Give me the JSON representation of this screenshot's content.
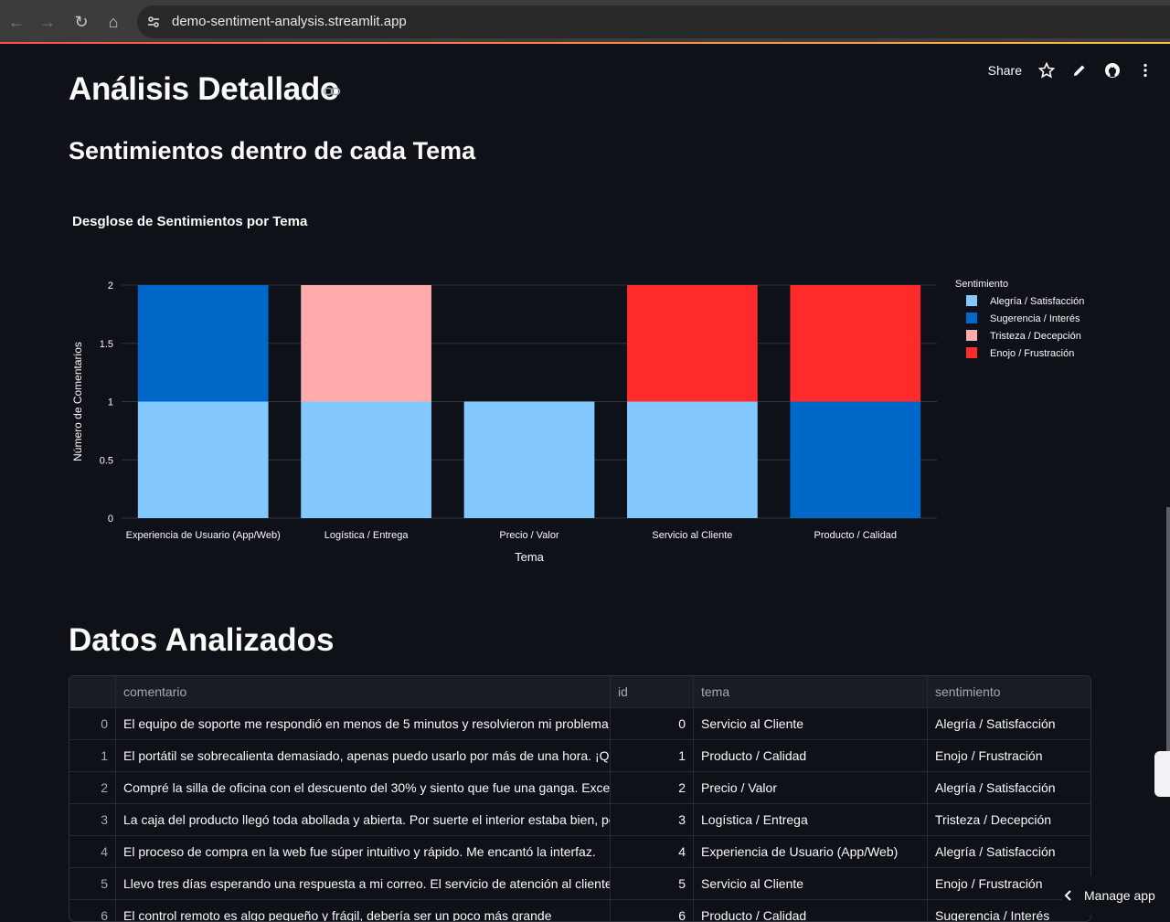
{
  "browser": {
    "url": "demo-sentiment-analysis.streamlit.app",
    "back_icon": "arrow-left-icon",
    "forward_icon": "arrow-right-icon",
    "reload_icon": "reload-icon",
    "home_icon": "home-icon"
  },
  "header": {
    "share_label": "Share"
  },
  "page": {
    "title": "Análisis Detallado",
    "section_title": "Sentimientos dentro de cada Tema",
    "data_title": "Datos Analizados"
  },
  "chart_data": {
    "type": "bar",
    "stacked": true,
    "title": "Desglose de Sentimientos por Tema",
    "xlabel": "Tema",
    "ylabel": "Número de Comentarios",
    "ylim": [
      0,
      2
    ],
    "yticks": [
      "0",
      "0.5",
      "1",
      "1.5",
      "2"
    ],
    "grid": true,
    "legend_title": "Sentimiento",
    "legend_position": "right",
    "categories": [
      "Experiencia de Usuario (App/Web)",
      "Logística / Entrega",
      "Precio / Valor",
      "Servicio al Cliente",
      "Producto / Calidad"
    ],
    "series": [
      {
        "name": "Alegría / Satisfacción",
        "color": "#83c9ff",
        "values": [
          1,
          1,
          1,
          1,
          0
        ]
      },
      {
        "name": "Sugerencia / Interés",
        "color": "#0068c9",
        "values": [
          1,
          0,
          0,
          0,
          1
        ]
      },
      {
        "name": "Tristeza / Decepción",
        "color": "#ffabab",
        "values": [
          0,
          1,
          0,
          0,
          0
        ]
      },
      {
        "name": "Enojo / Frustración",
        "color": "#ff2b2b",
        "values": [
          0,
          0,
          0,
          1,
          1
        ]
      }
    ]
  },
  "table": {
    "columns": [
      "",
      "comentario",
      "id",
      "tema",
      "sentimiento"
    ],
    "rows": [
      {
        "idx": "0",
        "comentario": "El equipo de soporte me respondió en menos de 5 minutos y resolvieron mi problema. ¡Un s",
        "id": "0",
        "tema": "Servicio al Cliente",
        "sentimiento": "Alegría / Satisfacción"
      },
      {
        "idx": "1",
        "comentario": "El portátil se sobrecalienta demasiado, apenas puedo usarlo por más de una hora. ¡Qué frus",
        "id": "1",
        "tema": "Producto / Calidad",
        "sentimiento": "Enojo / Frustración"
      },
      {
        "idx": "2",
        "comentario": "Compré la silla de oficina con el descuento del 30% y siento que fue una ganga. Excelente re",
        "id": "2",
        "tema": "Precio / Valor",
        "sentimiento": "Alegría / Satisfacción"
      },
      {
        "idx": "3",
        "comentario": "La caja del producto llegó toda abollada y abierta. Por suerte el interior estaba bien, pero la",
        "id": "3",
        "tema": "Logística / Entrega",
        "sentimiento": "Tristeza / Decepción"
      },
      {
        "idx": "4",
        "comentario": "El proceso de compra en la web fue súper intuitivo y rápido. Me encantó la interfaz.",
        "id": "4",
        "tema": "Experiencia de Usuario (App/Web)",
        "sentimiento": "Alegría / Satisfacción"
      },
      {
        "idx": "5",
        "comentario": "Llevo tres días esperando una respuesta a mi correo. El servicio de atención al cliente es inex",
        "id": "5",
        "tema": "Servicio al Cliente",
        "sentimiento": "Enojo / Frustración"
      },
      {
        "idx": "6",
        "comentario": "El control remoto es algo pequeño y frágil, debería ser un poco más grande",
        "id": "6",
        "tema": "Producto / Calidad",
        "sentimiento": "Sugerencia / Interés"
      }
    ]
  },
  "manage_app": {
    "label": "Manage app"
  }
}
